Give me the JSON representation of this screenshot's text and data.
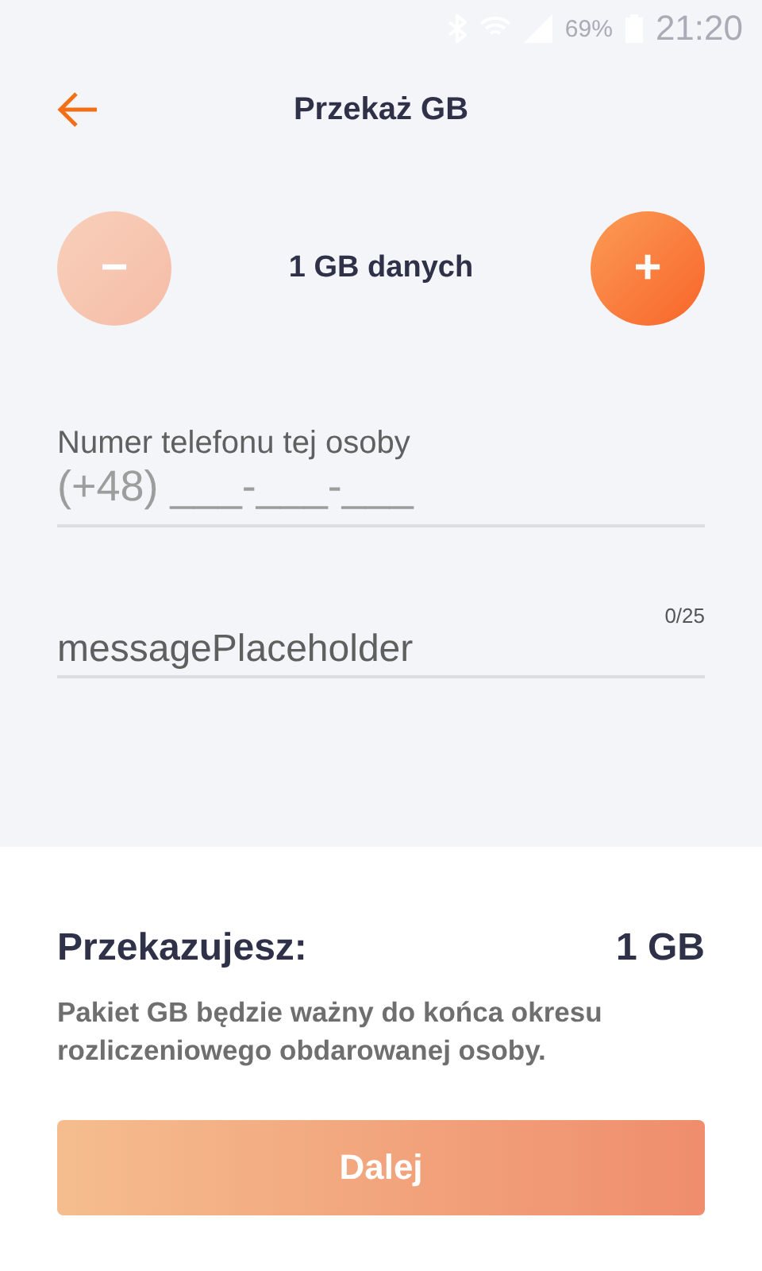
{
  "status_bar": {
    "battery": "69%",
    "time": "21:20"
  },
  "header": {
    "title": "Przekaż GB"
  },
  "stepper": {
    "value": "1 GB danych",
    "minus": {
      "label": "−",
      "disabled": true
    },
    "plus": {
      "label": "+",
      "disabled": false
    }
  },
  "phone_field": {
    "label": "Numer telefonu tej osoby",
    "placeholder": "(+48) ___-___-___"
  },
  "message_field": {
    "placeholder": "messagePlaceholder",
    "counter": "0/25"
  },
  "summary": {
    "label": "Przekazujesz:",
    "amount": "1 GB",
    "note": "Pakiet GB będzie ważny do końca okresu rozliczeniowego obdarowanej osoby."
  },
  "next_button": {
    "label": "Dalej",
    "disabled": true
  }
}
